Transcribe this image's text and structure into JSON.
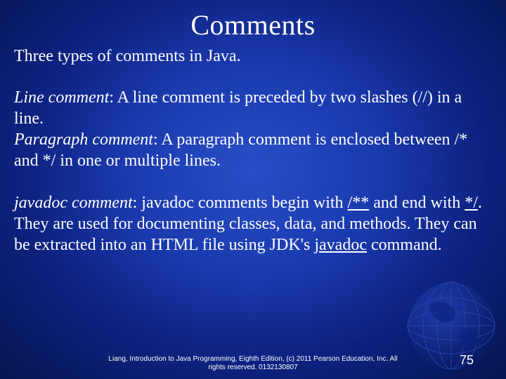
{
  "title": "Comments",
  "intro": "Three types of comments in Java.",
  "line_comment": {
    "term": "Line comment",
    "body": ": A line comment is preceded by two slashes (//) in a line."
  },
  "paragraph_comment": {
    "term": "Paragraph comment",
    "body": ": A paragraph comment is enclosed between /* and */ in one or multiple lines."
  },
  "javadoc_comment": {
    "term": "javadoc comment",
    "pre": ": javadoc comments begin with ",
    "open": "/**",
    "mid1": " and end with ",
    "close": "*/",
    "mid2": ". They are used for documenting classes, data, and methods. They can be extracted into an HTML file using JDK's ",
    "cmd": "javadoc",
    "post": " command."
  },
  "footer": {
    "line1": "Liang, Introduction to Java Programming, Eighth Edition, (c) 2011 Pearson Education, Inc. All",
    "line2": "rights reserved. 0132130807"
  },
  "page_number": "75"
}
